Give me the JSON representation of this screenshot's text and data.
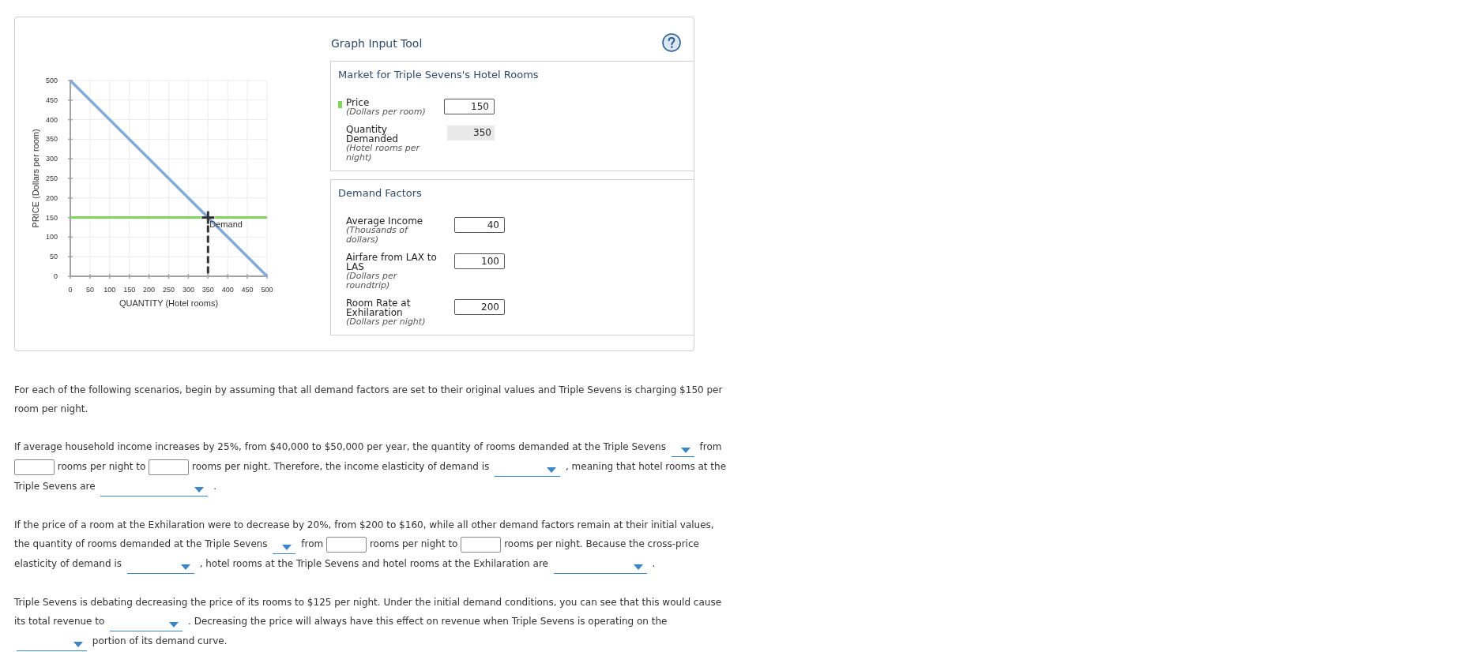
{
  "graph": {
    "chart_data": {
      "type": "line",
      "xlabel": "QUANTITY (Hotel rooms)",
      "ylabel": "PRICE (Dollars per room)",
      "x": [
        0,
        500
      ],
      "series": [
        {
          "color": "#84abd8",
          "values": [
            500,
            0
          ]
        },
        {
          "color": "#7fd45a",
          "values": [
            150,
            150
          ]
        }
      ],
      "xlim": [
        0,
        500
      ],
      "ylim": [
        0,
        500
      ],
      "xticks": [
        0,
        50,
        100,
        150,
        200,
        250,
        300,
        350,
        400,
        450,
        500
      ],
      "yticks": [
        0,
        50,
        100,
        150,
        200,
        250,
        300,
        350,
        400,
        450,
        500
      ],
      "grid": true,
      "annotations": [
        {
          "text": "Demand",
          "x": 350,
          "y": 150
        }
      ]
    }
  },
  "tool": {
    "title": "Graph Input Tool",
    "sections": [
      {
        "title": "Market for Triple Sevens's Hotel Rooms",
        "rows": [
          {
            "kind": "input",
            "label": "Price",
            "unit": "(Dollars per room)",
            "value": "150",
            "color": "#7fd45a"
          },
          {
            "kind": "readout",
            "label": "Quantity Demanded",
            "unit": "(Hotel rooms per night)",
            "value": "350"
          }
        ]
      },
      {
        "title": "Demand Factors",
        "rows": [
          {
            "kind": "input",
            "label": "Average Income",
            "unit": "(Thousands of dollars)",
            "value": "40"
          },
          {
            "kind": "input",
            "label": "Airfare from LAX to LAS",
            "unit": "(Dollars per roundtrip)",
            "value": "100"
          },
          {
            "kind": "input",
            "label": "Room Rate at Exhilaration",
            "unit": "(Dollars per night)",
            "value": "200"
          }
        ]
      }
    ]
  },
  "questions": [
    {
      "parts": [
        {
          "kind": "text",
          "text": "For each of the following scenarios, begin by assuming that all demand factors are set to their original values and Triple Sevens is charging $150 per room per night."
        }
      ]
    },
    {
      "parts": [
        {
          "kind": "text",
          "text": "If average household income increases by 25%, from $40,000 to $50,000 per year, the quantity of rooms demanded at the Triple Sevens"
        },
        {
          "kind": "dropdown"
        },
        {
          "kind": "text",
          "text": "from"
        },
        {
          "kind": "blank"
        },
        {
          "kind": "text",
          "text": "rooms per night to"
        },
        {
          "kind": "blank"
        },
        {
          "kind": "text",
          "text": "rooms per night. Therefore, the income elasticity of demand is"
        },
        {
          "kind": "dropdown"
        },
        {
          "kind": "text",
          "text": ", meaning that hotel rooms at the Triple Sevens are"
        },
        {
          "kind": "dropdown"
        },
        {
          "kind": "text",
          "text": "."
        }
      ]
    },
    {
      "parts": [
        {
          "kind": "text",
          "text": "If the price of a room at the Exhilaration were to decrease by 20%, from $200 to $160, while all other demand factors remain at their initial values, the quantity of rooms demanded at the Triple Sevens"
        },
        {
          "kind": "dropdown"
        },
        {
          "kind": "text",
          "text": "from"
        },
        {
          "kind": "blank"
        },
        {
          "kind": "text",
          "text": "rooms per night to"
        },
        {
          "kind": "blank"
        },
        {
          "kind": "text",
          "text": "rooms per night. Because the cross-price elasticity of demand is"
        },
        {
          "kind": "dropdown"
        },
        {
          "kind": "text",
          "text": ", hotel rooms at the Triple Sevens and hotel rooms at the Exhilaration are"
        },
        {
          "kind": "dropdown"
        },
        {
          "kind": "text",
          "text": "."
        }
      ]
    },
    {
      "parts": [
        {
          "kind": "text",
          "text": "Triple Sevens is debating decreasing the price of its rooms to $125 per night. Under the initial demand conditions, you can see that this would cause its total revenue to"
        },
        {
          "kind": "dropdown"
        },
        {
          "kind": "text",
          "text": ". Decreasing the price will always have this effect on revenue when Triple Sevens is operating on the"
        },
        {
          "kind": "dropdown"
        },
        {
          "kind": "text",
          "text": "portion of its demand curve."
        }
      ]
    }
  ]
}
